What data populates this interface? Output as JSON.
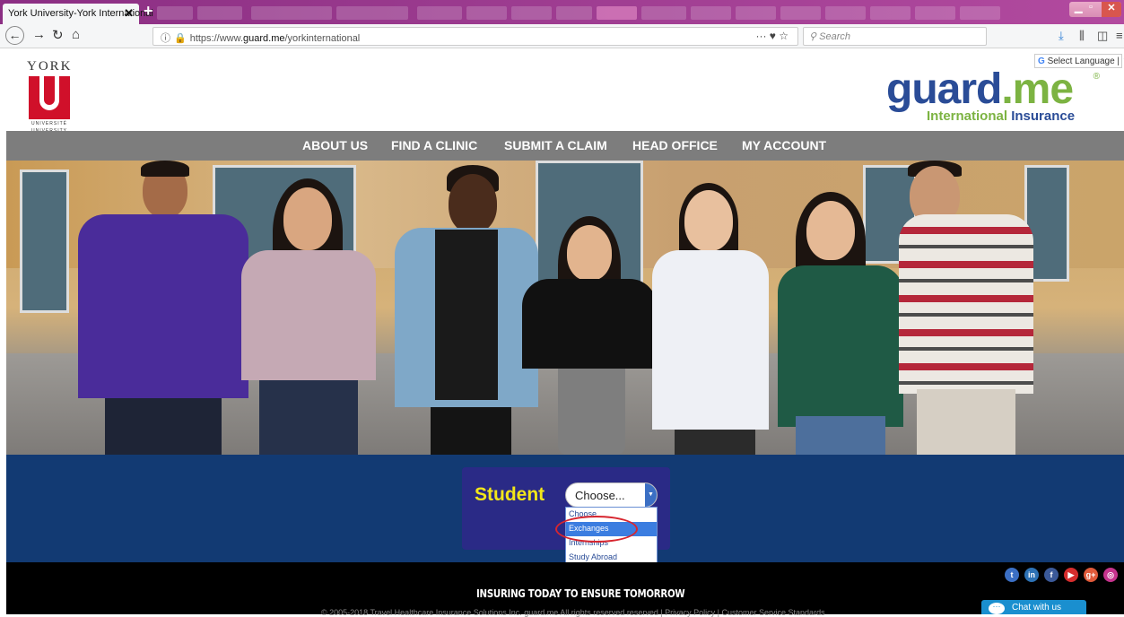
{
  "browser": {
    "tab_title": "York University-York International",
    "tab_close": "✕",
    "new_tab": "+",
    "url_prefix": "https://www.",
    "url_domain": "guard.me",
    "url_path": "/yorkinternational",
    "page_actions": "··· ♥ ☆",
    "search_placeholder": "Search"
  },
  "header": {
    "york_word": "YORK",
    "york_sub1": "UNIVERSITÉ",
    "york_sub2": "UNIVERSITY",
    "select_language": "Select Language",
    "guard_word_a": "guard",
    "guard_word_b": ".me",
    "guard_sub_a": "International",
    "guard_sub_b": "Insurance",
    "guard_reg": "®"
  },
  "nav": {
    "items": [
      "ABOUT US",
      "FIND A CLINIC",
      "SUBMIT A CLAIM",
      "HEAD OFFICE",
      "MY ACCOUNT"
    ]
  },
  "picker": {
    "label": "Student",
    "selected": "Choose...",
    "options": [
      "Choose",
      "Exchanges",
      "Internships",
      "Study Abroad"
    ],
    "highlighted_option": "Exchanges"
  },
  "footer": {
    "tagline": "INSURING TODAY TO ENSURE TOMORROW",
    "copyright": "© 2005-2018 Travel Healthcare Insurance Solutions Inc. guard.me All rights reserved reserved  | Privacy Policy   | Customer Service Standards",
    "chat_label": "Chat with us"
  },
  "colors": {
    "nav_bg": "#7d7d7d",
    "blue_section": "#123a73",
    "picker_label": "#f2e61a",
    "guard_blue": "#2a4c97",
    "guard_green": "#7cb342",
    "annotation_ellipse": "#d7262f"
  },
  "icons": {
    "social": [
      "twitter-icon",
      "linkedin-icon",
      "facebook-icon",
      "youtube-icon",
      "google-plus-icon",
      "instagram-icon"
    ]
  }
}
